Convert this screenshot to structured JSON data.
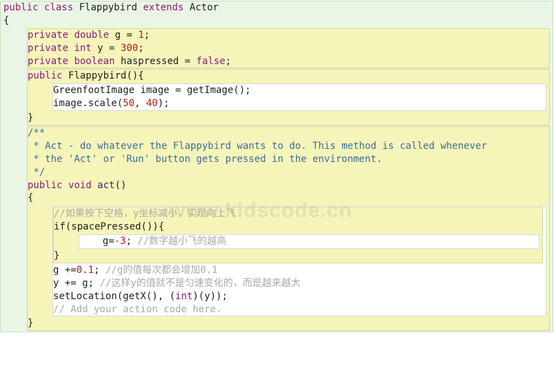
{
  "watermark": "www.kidscode.cn",
  "code": {
    "l1": {
      "kw1": "public",
      "kw2": "class",
      "name": "Flappybird",
      "kw3": "extends",
      "base": "Actor"
    },
    "l3_1": {
      "kw": "private",
      "type": "double",
      "rest": " g = ",
      "num": "1",
      "sc": ";"
    },
    "l3_2": {
      "kw": "private",
      "type": "int",
      "rest": " y = ",
      "num": "300",
      "sc": ";"
    },
    "l3_3": {
      "kw": "private",
      "type": "boolean",
      "rest": " haspressed = ",
      "lit": "false",
      "sc": ";"
    },
    "l4": {
      "kw": "public",
      "name": "Flappybird",
      "sig": "(){"
    },
    "l5": "GreenfootImage image = getImage();",
    "l6a": "image.scale(",
    "l6n1": "50",
    "l6c": ", ",
    "l6n2": "40",
    "l6b": ");",
    "doc1": "/**",
    "doc2": " * Act - do whatever the Flappybird wants to do. This method is called whenever",
    "doc3": " * the 'Act' or 'Run' button gets pressed in the environment.",
    "doc4": " */",
    "l10": {
      "kw1": "public",
      "kw2": "void",
      "name": "act",
      "sig": "()"
    },
    "c1": "//如果按下空格，y坐标减小，实现向上飞",
    "l12": "if(spacePressed()){",
    "l13a": "    g=",
    "l13n": "-3",
    "l13b": "; ",
    "l13c": "//数字越小飞的越高",
    "l14": "}",
    "l15a": "g +=",
    "l15n": "0.1",
    "l15b": "; ",
    "l15c": "//g的值每次都会增加0.1",
    "l16a": "y += g; ",
    "l16c": "//这样y的值就不是匀速变化的，而是越来越大",
    "l17a": "setLocation(getX(), (",
    "l17t": "int",
    "l17b": ")(y));",
    "l18": "// Add your action code here."
  }
}
